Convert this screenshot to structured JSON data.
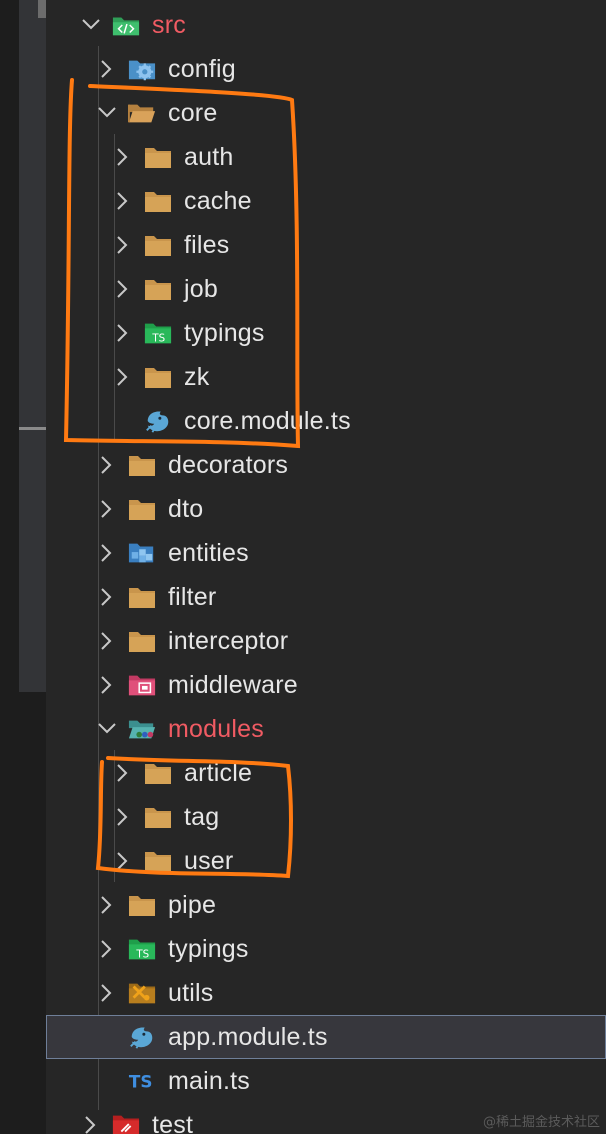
{
  "explorer": {
    "items": [
      {
        "label": "src",
        "icon": "src-folder-icon",
        "expanded": true,
        "label_color": "#f05b63"
      },
      {
        "label": "config",
        "icon": "config-folder-icon",
        "expanded": false
      },
      {
        "label": "core",
        "icon": "open-folder-icon",
        "expanded": true
      },
      {
        "label": "auth",
        "icon": "folder-icon",
        "expanded": false
      },
      {
        "label": "cache",
        "icon": "folder-icon",
        "expanded": false
      },
      {
        "label": "files",
        "icon": "folder-icon",
        "expanded": false
      },
      {
        "label": "job",
        "icon": "folder-icon",
        "expanded": false
      },
      {
        "label": "typings",
        "icon": "typings-folder-icon",
        "expanded": false
      },
      {
        "label": "zk",
        "icon": "folder-icon",
        "expanded": false
      },
      {
        "label": "core.module.ts",
        "icon": "nest-module-icon"
      },
      {
        "label": "decorators",
        "icon": "folder-icon",
        "expanded": false
      },
      {
        "label": "dto",
        "icon": "folder-icon",
        "expanded": false
      },
      {
        "label": "entities",
        "icon": "entities-folder-icon",
        "expanded": false
      },
      {
        "label": "filter",
        "icon": "folder-icon",
        "expanded": false
      },
      {
        "label": "interceptor",
        "icon": "folder-icon",
        "expanded": false
      },
      {
        "label": "middleware",
        "icon": "middleware-folder-icon",
        "expanded": false
      },
      {
        "label": "modules",
        "icon": "modules-folder-icon",
        "expanded": true,
        "label_color": "#f05b63"
      },
      {
        "label": "article",
        "icon": "folder-icon",
        "expanded": false
      },
      {
        "label": "tag",
        "icon": "folder-icon",
        "expanded": false
      },
      {
        "label": "user",
        "icon": "folder-icon",
        "expanded": false
      },
      {
        "label": "pipe",
        "icon": "folder-icon",
        "expanded": false
      },
      {
        "label": "typings",
        "icon": "typings-folder-icon",
        "expanded": false
      },
      {
        "label": "utils",
        "icon": "utils-folder-icon",
        "expanded": false
      },
      {
        "label": "app.module.ts",
        "icon": "nest-module-icon",
        "selected": true
      },
      {
        "label": "main.ts",
        "icon": "typescript-file-icon"
      },
      {
        "label": "test",
        "icon": "test-folder-icon",
        "expanded": false
      }
    ]
  },
  "annotations": {
    "color": "#ff7a12"
  },
  "watermark": "@稀土掘金技术社区",
  "colors": {
    "background": "#262626",
    "folder": "#c9954c",
    "text": "#e6e6e6",
    "accent_red": "#f05b63",
    "selection_border": "#6f7f99"
  }
}
